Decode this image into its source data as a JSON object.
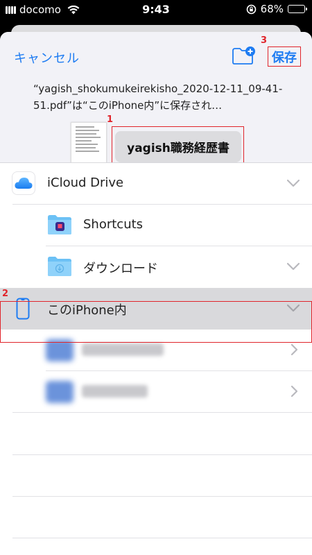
{
  "status_bar": {
    "carrier": "docomo",
    "time": "9:43",
    "battery": "68%",
    "battery_level": 0.68
  },
  "header": {
    "cancel_label": "キャンセル",
    "save_label": "保存",
    "message": "“yagish_shokumukeirekisho_2020-12-11_09-41-51.pdf”は“このiPhone内”に保存され…",
    "filename": "yagish職務経歴書"
  },
  "annotations": {
    "one": "1",
    "two": "2",
    "three": "3"
  },
  "locations": {
    "icloud": {
      "label": "iCloud Drive",
      "icon": "icloud-icon"
    },
    "shortcuts": {
      "label": "Shortcuts",
      "icon": "shortcuts-folder-icon"
    },
    "downloads": {
      "label": "ダウンロード",
      "icon": "download-folder-icon"
    },
    "on_iphone": {
      "label": "このiPhone内",
      "icon": "iphone-icon",
      "selected": true
    },
    "app1": {
      "label": "",
      "icon": "app-folder-icon"
    },
    "app2": {
      "label": "",
      "icon": "app-folder-icon"
    }
  },
  "colors": {
    "accent": "#1e7cf2",
    "highlight": "#e0242b",
    "selected_row": "#d9d9dc"
  }
}
